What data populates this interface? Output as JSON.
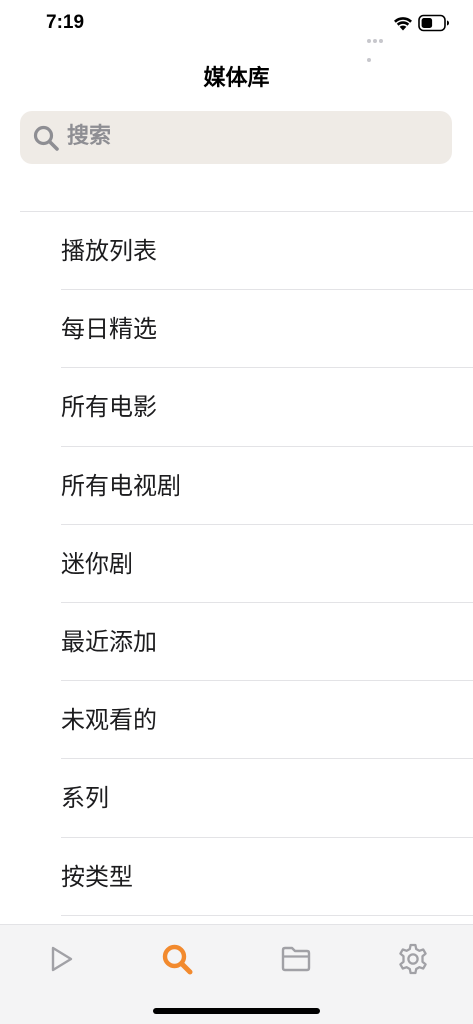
{
  "status_bar": {
    "time": "7:19",
    "icons": [
      "cellular-icon",
      "wifi-icon",
      "battery-icon"
    ]
  },
  "header": {
    "title": "媒体库"
  },
  "search": {
    "placeholder": "搜索"
  },
  "menu": {
    "items": [
      {
        "label": "播放列表"
      },
      {
        "label": "每日精选"
      },
      {
        "label": "所有电影"
      },
      {
        "label": "所有电视剧"
      },
      {
        "label": "迷你剧"
      },
      {
        "label": "最近添加"
      },
      {
        "label": "未观看的"
      },
      {
        "label": "系列"
      },
      {
        "label": "按类型"
      }
    ]
  },
  "tab_bar": {
    "active_tab": "search",
    "tabs": [
      {
        "id": "play",
        "icon": "play-icon"
      },
      {
        "id": "search",
        "icon": "search-icon"
      },
      {
        "id": "folder",
        "icon": "folder-icon"
      },
      {
        "id": "settings",
        "icon": "gear-icon"
      }
    ]
  },
  "colors": {
    "accent": "#f28a2e",
    "tab_inactive": "#a1a1a6",
    "search_bg": "#efebe6",
    "placeholder": "#8e8e93"
  }
}
